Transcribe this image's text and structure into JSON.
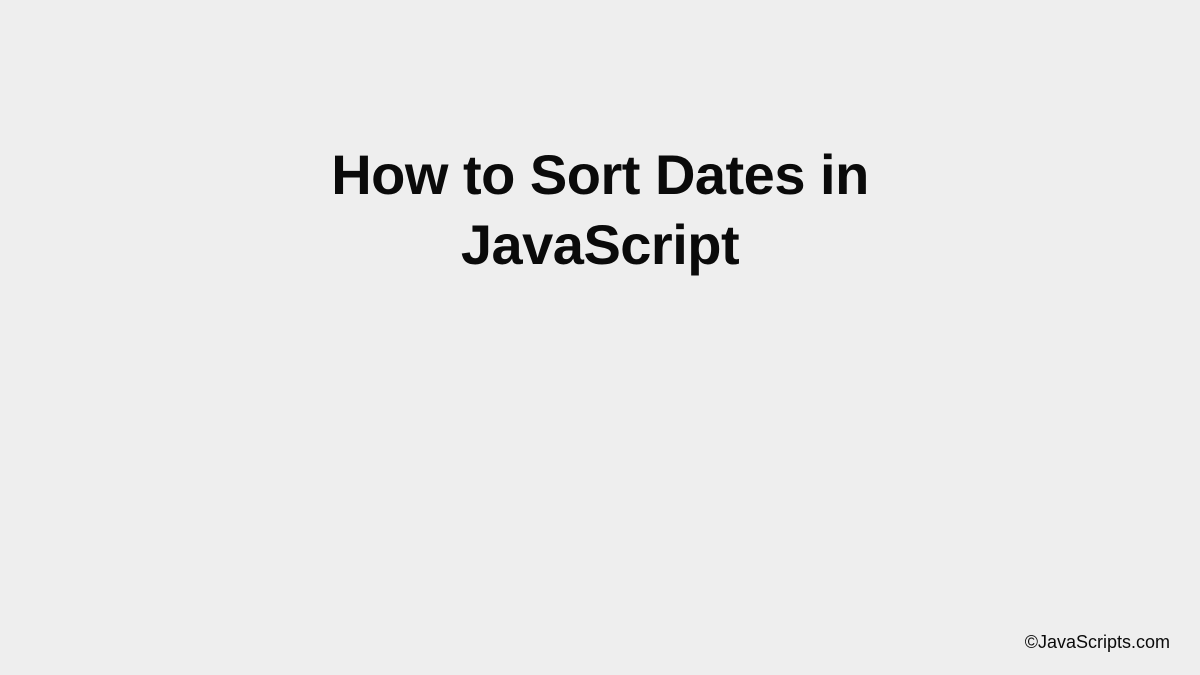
{
  "title_line1": "How to Sort Dates in",
  "title_line2": "JavaScript",
  "attribution": "©JavaScripts.com"
}
